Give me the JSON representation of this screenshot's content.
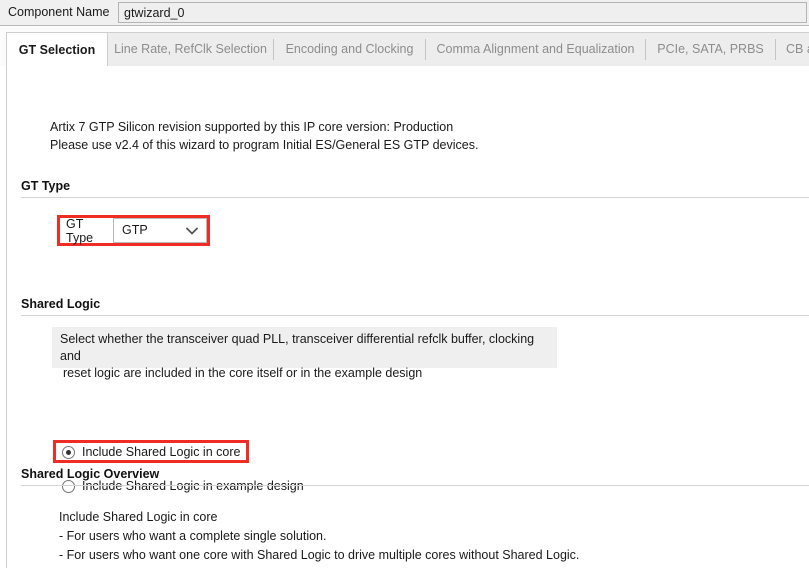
{
  "component": {
    "label": "Component Name",
    "value": "gtwizard_0"
  },
  "tabs": [
    {
      "label": "GT Selection",
      "active": true
    },
    {
      "label": "Line Rate, RefClk Selection",
      "active": false
    },
    {
      "label": "Encoding and Clocking",
      "active": false
    },
    {
      "label": "Comma Alignment and Equalization",
      "active": false
    },
    {
      "label": "PCIe, SATA, PRBS",
      "active": false
    },
    {
      "label": "CB an",
      "active": false
    }
  ],
  "info": {
    "line1": "Artix 7 GTP Silicon revision supported by this IP core version: Production",
    "line2": "Please use v2.4 of this wizard to program Initial ES/General ES GTP devices."
  },
  "gt_type": {
    "section_title": "GT Type",
    "field_label": "GT Type",
    "selected": "GTP",
    "options": [
      "GTP"
    ],
    "dropdown_icon": "chevron-down-icon",
    "highlight_color": "#ef2d25"
  },
  "shared_logic": {
    "section_title": "Shared Logic",
    "description_line1": "Select whether the transceiver quad PLL, transceiver differential refclk buffer, clocking and",
    "description_line2": "reset logic are included in the core itself or in the example design",
    "options": [
      {
        "label": "Include Shared Logic in core",
        "selected": true
      },
      {
        "label": "Include Shared Logic in example design",
        "selected": false
      }
    ],
    "highlight_color": "#ef2d25"
  },
  "overview": {
    "section_title": "Shared Logic Overview",
    "lines": [
      "Include Shared Logic in core",
      "- For users who want a complete single solution.",
      "- For users who want one core with Shared Logic to drive multiple cores without Shared Logic."
    ]
  }
}
